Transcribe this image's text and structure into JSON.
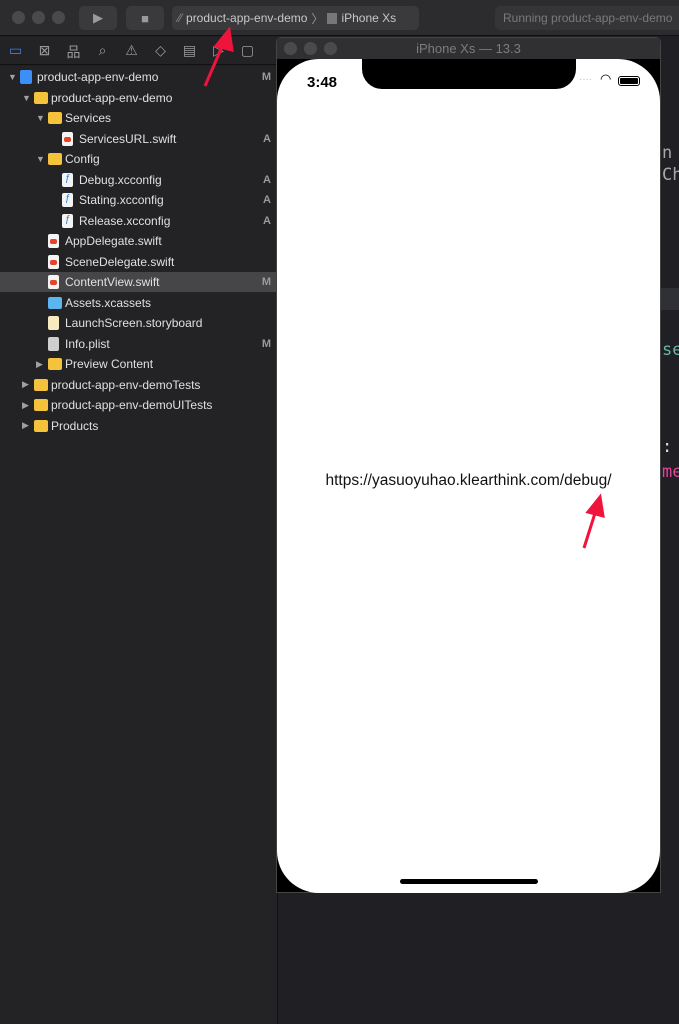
{
  "toolbar": {
    "scheme": "product-app-env-demo",
    "device": "iPhone Xs",
    "status": "Running product-app-env-demo"
  },
  "navigator_icons": [
    "folder-icon",
    "source-control-icon",
    "hierarchy-icon",
    "search-icon",
    "warning-icon",
    "test-icon",
    "debug-icon",
    "breakpoint-icon",
    "report-icon"
  ],
  "tree": [
    {
      "label": "product-app-env-demo",
      "level": 0,
      "type": "project",
      "expanded": true,
      "badge": "M"
    },
    {
      "label": "product-app-env-demo",
      "level": 1,
      "type": "folder",
      "expanded": true,
      "badge": ""
    },
    {
      "label": "Services",
      "level": 2,
      "type": "folder",
      "expanded": true,
      "badge": ""
    },
    {
      "label": "ServicesURL.swift",
      "level": 3,
      "type": "swift",
      "badge": "A"
    },
    {
      "label": "Config",
      "level": 2,
      "type": "folder",
      "expanded": true,
      "badge": ""
    },
    {
      "label": "Debug.xcconfig",
      "level": 3,
      "type": "xcconfig",
      "badge": "A"
    },
    {
      "label": "Stating.xcconfig",
      "level": 3,
      "type": "xcconfig",
      "badge": "A"
    },
    {
      "label": "Release.xcconfig",
      "level": 3,
      "type": "xcconfig",
      "badge": "A"
    },
    {
      "label": "AppDelegate.swift",
      "level": 2,
      "type": "swift",
      "badge": ""
    },
    {
      "label": "SceneDelegate.swift",
      "level": 2,
      "type": "swift",
      "badge": ""
    },
    {
      "label": "ContentView.swift",
      "level": 2,
      "type": "swift",
      "badge": "M",
      "selected": true
    },
    {
      "label": "Assets.xcassets",
      "level": 2,
      "type": "assets",
      "badge": ""
    },
    {
      "label": "LaunchScreen.storyboard",
      "level": 2,
      "type": "storyboard",
      "badge": ""
    },
    {
      "label": "Info.plist",
      "level": 2,
      "type": "plist",
      "badge": "M"
    },
    {
      "label": "Preview Content",
      "level": 2,
      "type": "folder",
      "expanded": false,
      "badge": ""
    },
    {
      "label": "product-app-env-demoTests",
      "level": 1,
      "type": "folder",
      "expanded": false,
      "badge": ""
    },
    {
      "label": "product-app-env-demoUITests",
      "level": 1,
      "type": "folder",
      "expanded": false,
      "badge": ""
    },
    {
      "label": "Products",
      "level": 1,
      "type": "folder",
      "expanded": false,
      "badge": ""
    }
  ],
  "editor_fragments": [
    "n",
    "Ch",
    "se",
    ":",
    "me"
  ],
  "simulator": {
    "title": "iPhone Xs — 13.3",
    "time": "3:48",
    "url": "https://yasuoyuhao.klearthink.com/debug/"
  },
  "colors": {
    "accent_arrow": "#f0143c",
    "folder": "#f5c33b",
    "selection": "#464649"
  }
}
